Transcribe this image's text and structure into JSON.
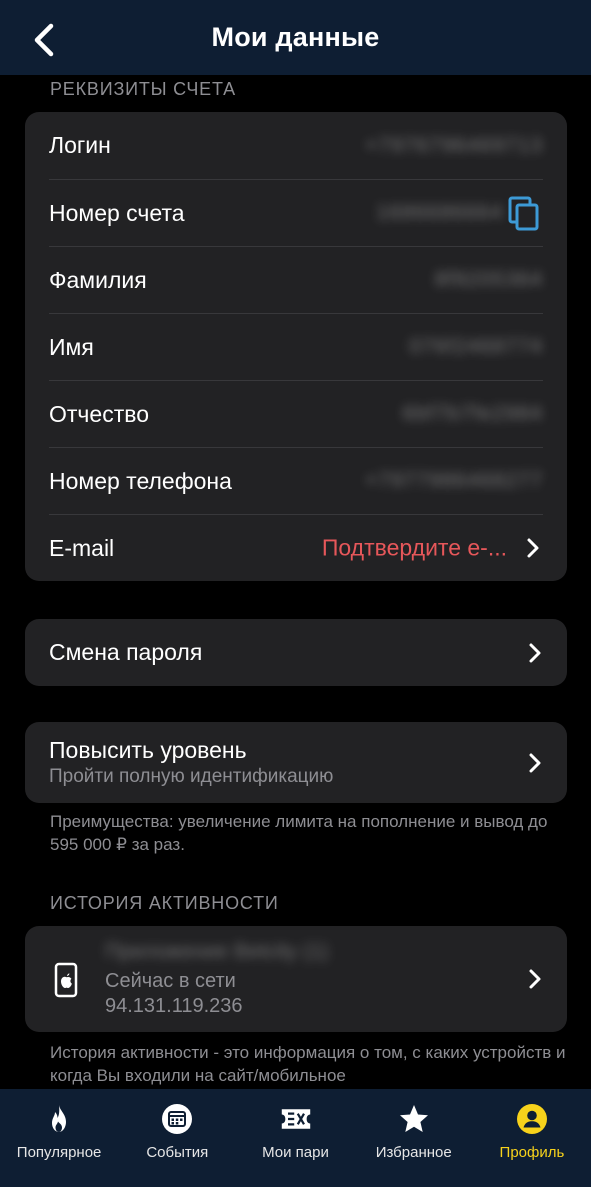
{
  "header": {
    "title": "Мои данные"
  },
  "account_section": {
    "label": "РЕКВИЗИТЫ СЧЕТА",
    "rows": [
      {
        "label": "Логин",
        "value": "+7976796469713"
      },
      {
        "label": "Номер счета",
        "value": "1686686664"
      },
      {
        "label": "Фамилия",
        "value": "8f9205364"
      },
      {
        "label": "Имя",
        "value": "076f2468774"
      },
      {
        "label": "Отчество",
        "value": "6bf7b7fe2984"
      },
      {
        "label": "Номер телефона",
        "value": "+7977986468277"
      },
      {
        "label": "E-mail",
        "value": "Подтвердите e-..."
      }
    ]
  },
  "password": {
    "label": "Смена пароля"
  },
  "upgrade": {
    "title": "Повысить уровень",
    "subtitle": "Пройти полную идентификацию",
    "note": "Преимущества: увеличение лимита на пополнение и вывод до 595 000 ₽ за раз."
  },
  "activity_section": {
    "label": "ИСТОРИЯ АКТИВНОСТИ",
    "item": {
      "app": "Приложение Betcity (1)",
      "status": "Сейчас в сети",
      "ip": "94.131.119.236"
    },
    "note": "История активности - это информация о том, с каких устройств и когда Вы входили на сайт/мобильное"
  },
  "tabbar": {
    "tabs": [
      {
        "label": "Популярное",
        "icon": "flame-icon"
      },
      {
        "label": "События",
        "icon": "calendar-icon"
      },
      {
        "label": "Мои пари",
        "icon": "ticket-icon"
      },
      {
        "label": "Избранное",
        "icon": "star-icon"
      },
      {
        "label": "Профиль",
        "icon": "profile-icon",
        "active": true
      }
    ],
    "active_color": "#f7d21b"
  },
  "colors": {
    "header_bg": "#0e1e33",
    "card_bg": "#222224",
    "warning": "#e6575a",
    "copy_icon": "#3d9ad6"
  }
}
